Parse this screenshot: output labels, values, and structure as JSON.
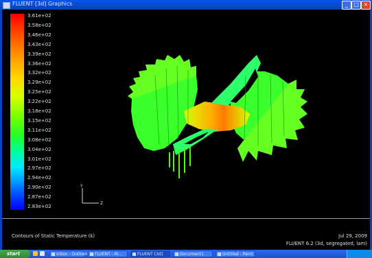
{
  "window": {
    "title": "FLUENT [3d] Graphics"
  },
  "colorbar": {
    "labels": [
      "3.61e+02",
      "3.58e+02",
      "3.46e+02",
      "3.43e+02",
      "3.39e+02",
      "3.36e+02",
      "3.32e+02",
      "3.29e+02",
      "3.25e+02",
      "3.22e+02",
      "3.18e+02",
      "3.15e+02",
      "3.11e+02",
      "3.08e+02",
      "3.04e+02",
      "3.01e+02",
      "2.97e+02",
      "2.94e+02",
      "2.90e+02",
      "2.87e+02",
      "2.83e+02"
    ],
    "colors": [
      "#ff0000",
      "#ff9900",
      "#ffd800",
      "#7cff00",
      "#00ff9a",
      "#00eaff",
      "#0000ff"
    ]
  },
  "axes": {
    "x": "Z",
    "y": "Y"
  },
  "info": {
    "caption": "Contours of Static Temperature (k)",
    "date": "Jul 29, 2009",
    "version": "FLUENT 6.2 (3d, segregated, lam)"
  },
  "taskbar": {
    "start_label": "start",
    "tasks": [
      "Inbox - Outlook",
      "FLUENT - M...",
      "FLUENT [3d]",
      "Document1",
      "Untitled - Paint"
    ]
  }
}
